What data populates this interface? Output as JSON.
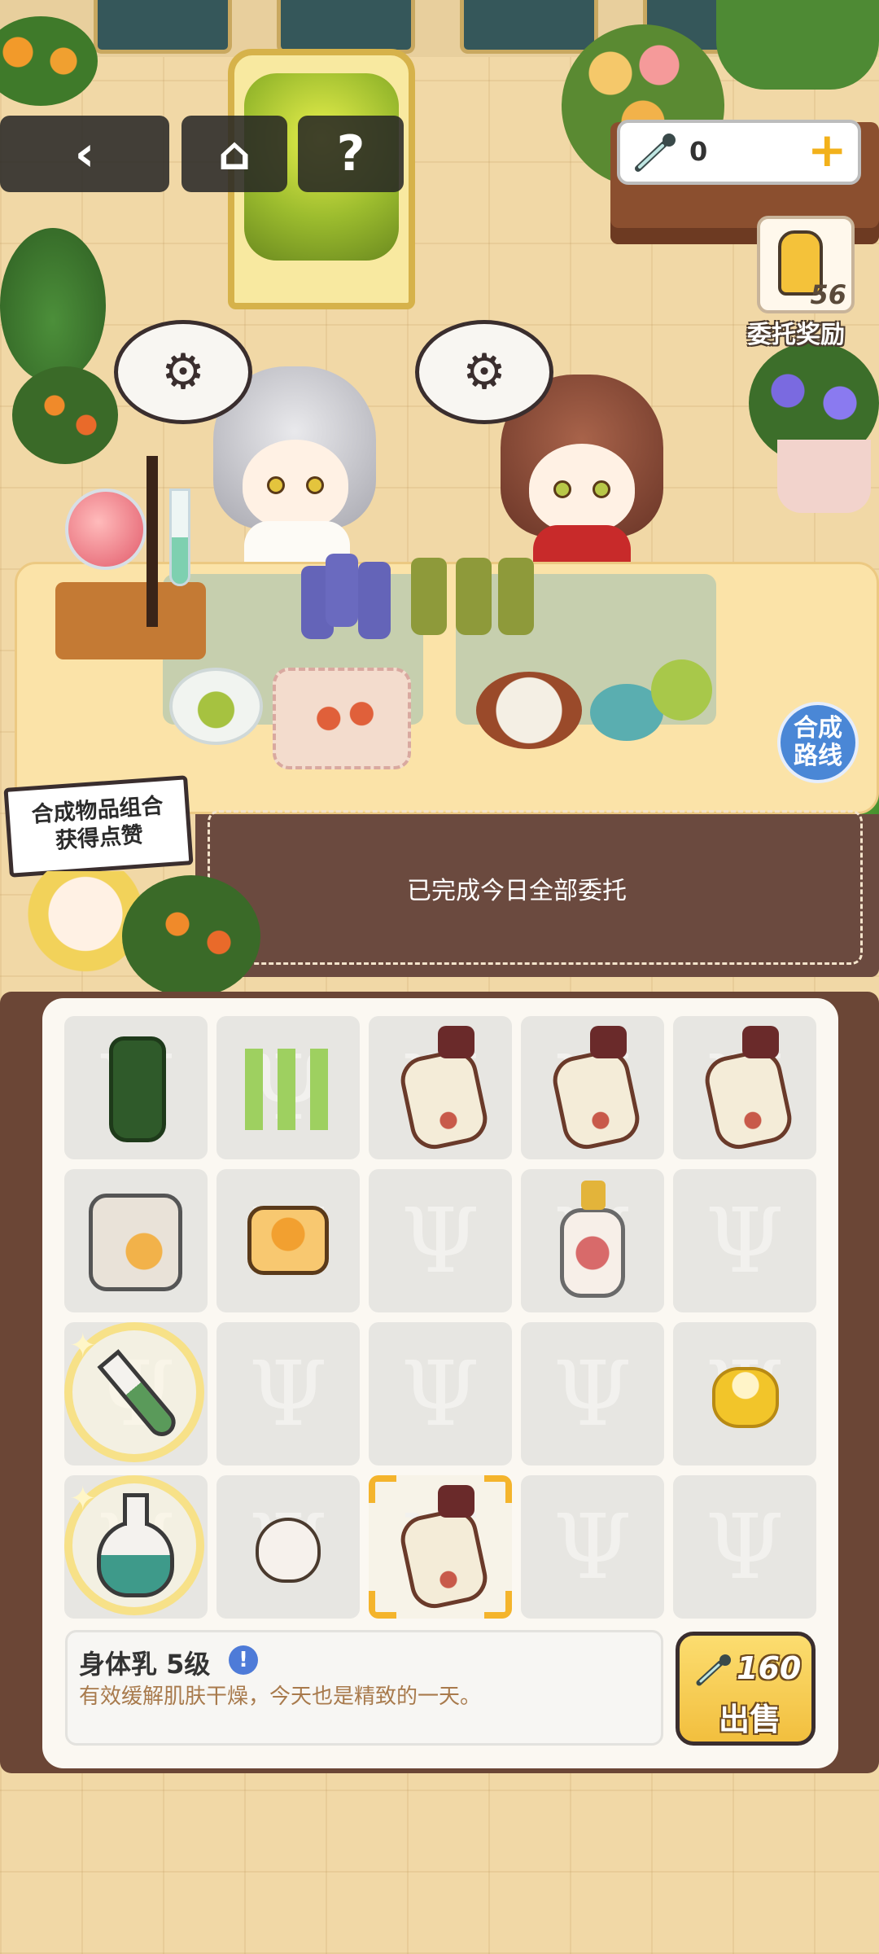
{
  "nav": {
    "back_icon": "‹",
    "home_icon": "⌂",
    "help_label": "?"
  },
  "currency": {
    "icon": "pipette-icon",
    "value": "0",
    "plus_label": "+"
  },
  "reward": {
    "icon": "thumbs-up-icon",
    "count": "56",
    "label": "委托奖励"
  },
  "route_button": {
    "label_line1": "合成",
    "label_line2": "路线"
  },
  "sign": {
    "line1": "合成物品组合",
    "line2": "获得点赞"
  },
  "status": {
    "complete_text": "已完成今日全部委托"
  },
  "inventory": {
    "placeholder_glyph": "Ψ",
    "rows": [
      [
        "dark-green-bottle",
        "green-ampoules",
        "body-lotion",
        "body-lotion",
        "body-lotion"
      ],
      [
        "ice-jar",
        "orange-soap",
        "empty",
        "perfume-bottle",
        "empty"
      ],
      [
        "sparkle-test-tube",
        "empty",
        "empty",
        "empty",
        "gold-pot"
      ],
      [
        "sparkle-flask",
        "garlic-bulb",
        "body-lotion-selected",
        "empty",
        "empty"
      ]
    ]
  },
  "selected_item": {
    "name": "身体乳 5级",
    "badge": "!",
    "description": "有效缓解肌肤干燥，今天也是精致的一天。"
  },
  "sell": {
    "price": "160",
    "label": "出售"
  },
  "colors": {
    "panel_frame": "#6b4636",
    "sell_button": "#f2bf3e",
    "route_button": "#4a87d6",
    "selection_corner": "#f4b42c"
  }
}
